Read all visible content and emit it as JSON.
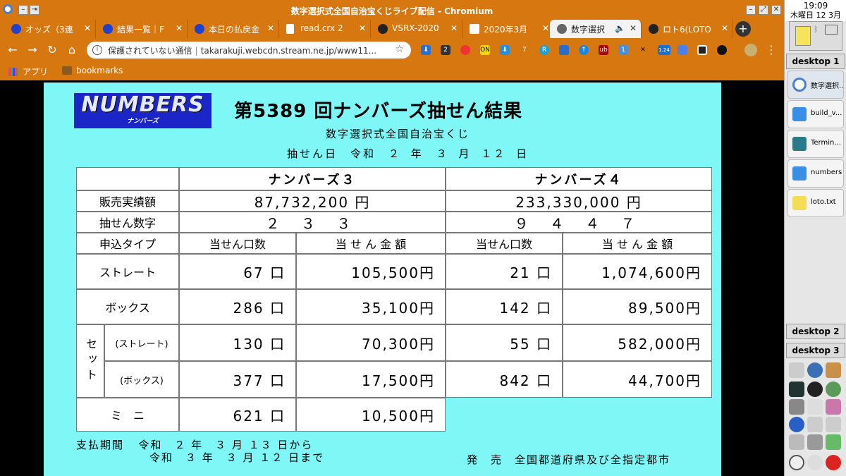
{
  "window": {
    "title": "数字選択式全国自治宝くじライブ配信 - Chromium"
  },
  "tabs": [
    {
      "label": "オッズ（3連",
      "icon": "blue-circle-icon"
    },
    {
      "label": "結果一覧｜F",
      "icon": "blue-circle-icon"
    },
    {
      "label": "本日の払戻金",
      "icon": "blue-circle-icon"
    },
    {
      "label": "read.crx 2",
      "icon": "doc-icon"
    },
    {
      "label": "VSRX-2020",
      "icon": "github-icon"
    },
    {
      "label": "2020年3月",
      "icon": "page-icon"
    },
    {
      "label": "数字選択",
      "icon": "globe-icon",
      "active": true
    },
    {
      "label": "ロト6(LOTO",
      "icon": "github-icon"
    }
  ],
  "address": {
    "security": "保護されていない通信",
    "url": "takarakuji.webcdn.stream.ne.jp/www11..."
  },
  "bookmarks": [
    {
      "label": "アプリ"
    },
    {
      "label": "bookmarks"
    }
  ],
  "result": {
    "logo_text": "NUMBERS",
    "logo_sub": "ナンバーズ",
    "heading": "第5389 回ナンバーズ抽せん結果",
    "subheading": "数字選択式全国自治宝くじ",
    "draw_date": "抽せん日　令和　２ 年　３ 月 １２ 日",
    "n3_title": "ナンバーズ３",
    "n4_title": "ナンバーズ４",
    "sales_label": "販売実績額",
    "n3_sales": "87,732,200 円",
    "n4_sales": "233,330,000 円",
    "numbers_label": "抽せん数字",
    "n3_numbers": "２ ３ ３",
    "n4_numbers": "９ ４ ４ ７",
    "type_label": "申込タイプ",
    "count_header": "当せん口数",
    "amount_header": "当 せ ん 金 額",
    "rows": [
      {
        "label": "ストレート",
        "n3_count": "67 口",
        "n3_amount": "105,500円",
        "n4_count": "21 口",
        "n4_amount": "1,074,600円"
      },
      {
        "label": "ボックス",
        "n3_count": "286 口",
        "n3_amount": "35,100円",
        "n4_count": "142 口",
        "n4_amount": "89,500円"
      },
      {
        "label": "(ストレート)",
        "n3_count": "130 口",
        "n3_amount": "70,300円",
        "n4_count": "55 口",
        "n4_amount": "582,000円"
      },
      {
        "label": "(ボックス)",
        "n3_count": "377 口",
        "n3_amount": "17,500円",
        "n4_count": "842 口",
        "n4_amount": "44,700円"
      },
      {
        "label": "ミ　ニ",
        "n3_count": "621 口",
        "n3_amount": "10,500円"
      }
    ],
    "set_label": "セット",
    "payment_label": "支払期間",
    "payment_from": "令和　２ 年　３ 月 １３ 日から",
    "payment_to": "令和　３ 年　３ 月 １２ 日まで",
    "seller": "発　売　全国都道府県及び全指定都市"
  },
  "panel": {
    "time": "19:09",
    "date": "木曜日 12 3月",
    "desktops": [
      "desktop 1",
      "desktop 2",
      "desktop 3"
    ],
    "tasks": [
      {
        "label": "数字選択...",
        "icon": "chromium-icon"
      },
      {
        "label": "build_v...",
        "icon": "folder-icon"
      },
      {
        "label": "Termin...",
        "icon": "terminal-icon"
      },
      {
        "label": "numbers",
        "icon": "folder-icon"
      },
      {
        "label": "loto.txt",
        "icon": "text-file-icon"
      }
    ]
  }
}
